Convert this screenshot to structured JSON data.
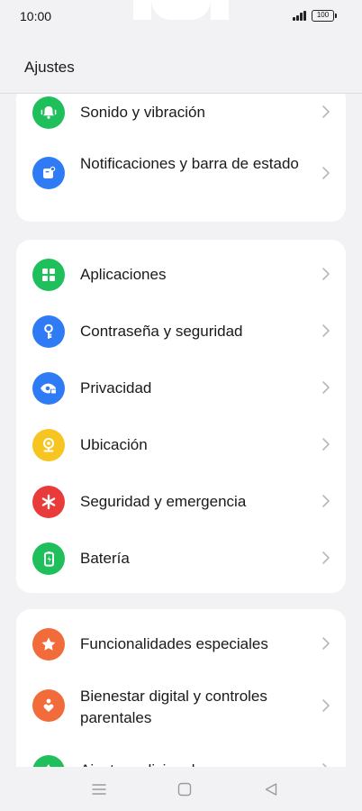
{
  "status_bar": {
    "time": "10:00",
    "battery_level": "100"
  },
  "header": {
    "title": "Ajustes"
  },
  "groups": [
    {
      "items": [
        {
          "label": "Sonido y vibración",
          "icon": "bell-vibration-icon",
          "color": "#1fbf5c"
        },
        {
          "label": "Notificaciones y barra de estado",
          "icon": "notification-icon",
          "color": "#2f7bf5"
        }
      ]
    },
    {
      "items": [
        {
          "label": "Aplicaciones",
          "icon": "apps-grid-icon",
          "color": "#1fbf5c"
        },
        {
          "label": "Contraseña y seguridad",
          "icon": "key-icon",
          "color": "#2f7bf5"
        },
        {
          "label": "Privacidad",
          "icon": "privacy-eye-icon",
          "color": "#2f7bf5"
        },
        {
          "label": "Ubicación",
          "icon": "location-pin-icon",
          "color": "#f6c522"
        },
        {
          "label": "Seguridad y emergencia",
          "icon": "asterisk-icon",
          "color": "#ea3b3b"
        },
        {
          "label": "Batería",
          "icon": "battery-icon",
          "color": "#1fbf5c"
        }
      ]
    },
    {
      "items": [
        {
          "label": "Funcionalidades especiales",
          "icon": "star-icon",
          "color": "#f26b3a"
        },
        {
          "label": "Bienestar digital y controles parentales",
          "icon": "heart-person-icon",
          "color": "#f26b3a"
        },
        {
          "label": "Ajustes adicionales",
          "icon": "gear-icon",
          "color": "#1fbf5c"
        }
      ]
    }
  ],
  "nav": {
    "menu_icon": "menu-lines-icon",
    "home_icon": "home-square-icon",
    "back_icon": "back-triangle-icon"
  }
}
